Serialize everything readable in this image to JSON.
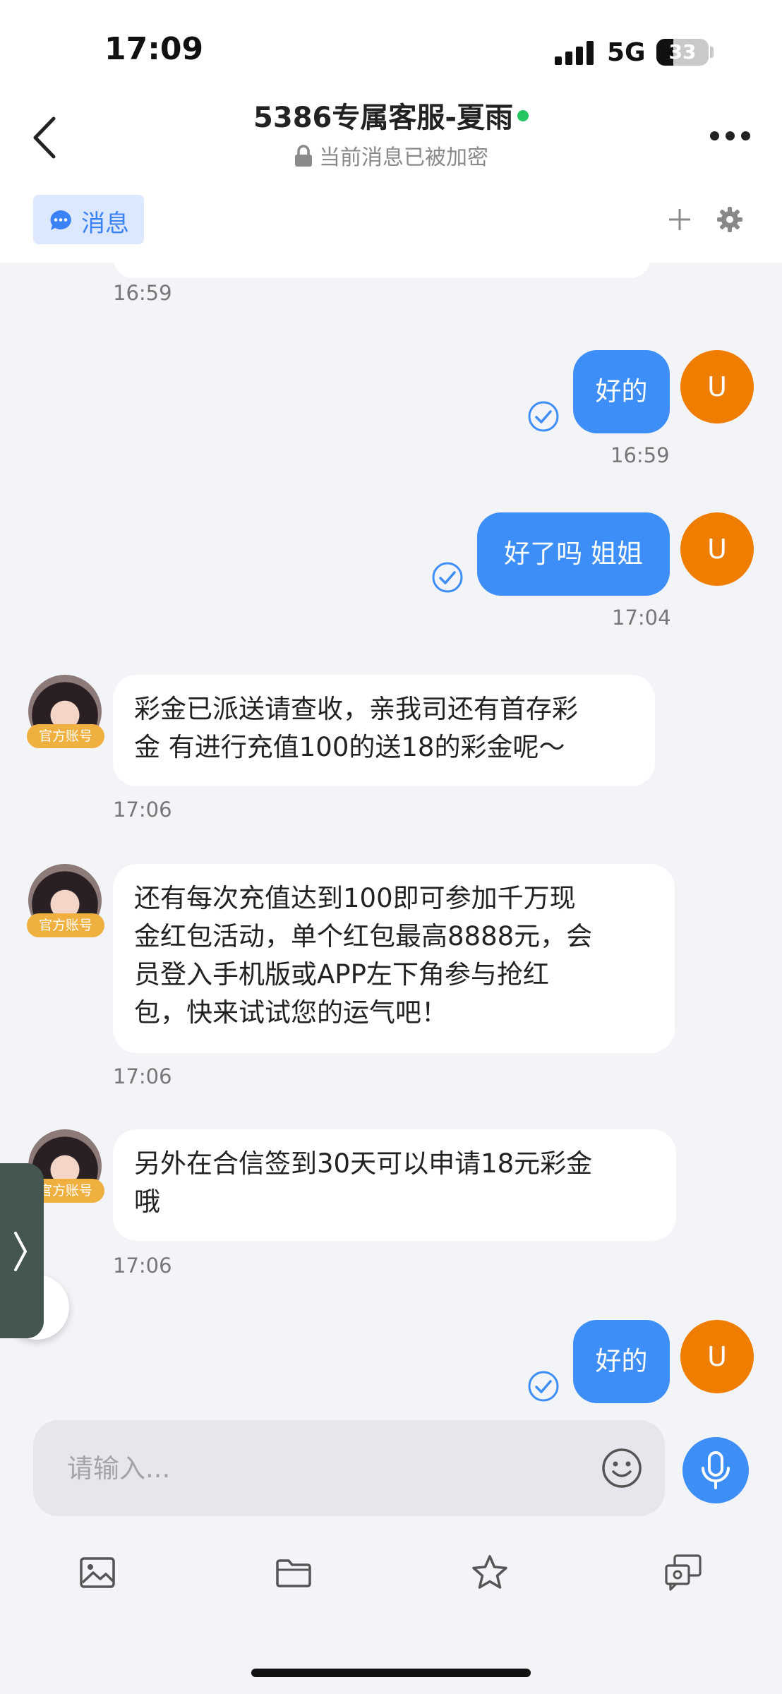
{
  "status_bar": {
    "time": "17:09",
    "network": "5G",
    "battery": "33",
    "battery_level": 0.33
  },
  "header": {
    "title": "5386专属客服-夏雨",
    "subtitle": "当前消息已被加密",
    "online_color": "#22c55e"
  },
  "tabs": {
    "message": "消息"
  },
  "colors": {
    "accent": "#3e8ef7",
    "user_avatar": "#ef7d00",
    "badge": "#f0b040"
  },
  "messages": [
    {
      "from": "agent-partial",
      "time": "16:59"
    },
    {
      "from": "user",
      "text": "好的",
      "time": "16:59",
      "avatar": "U"
    },
    {
      "from": "user",
      "text": "好了吗 姐姐",
      "time": "17:04",
      "avatar": "U"
    },
    {
      "from": "agent",
      "badge": "官方账号",
      "lines": [
        "彩金已派送请查收，亲我司还有首存彩",
        "金 有进行充值100的送18的彩金呢～"
      ],
      "time": "17:06"
    },
    {
      "from": "agent",
      "badge": "官方账号",
      "lines": [
        "还有每次充值达到100即可参加千万现",
        "金红包活动，单个红包最高8888元，会",
        "员登入手机版或APP左下角参与抢红",
        "包，快来试试您的运气吧！"
      ],
      "time": "17:06"
    },
    {
      "from": "agent",
      "badge": "官方账号",
      "lines": [
        "另外在合信签到30天可以申请18元彩金",
        "哦"
      ],
      "time": "17:06"
    },
    {
      "from": "user",
      "text": "好的",
      "avatar": "U"
    }
  ],
  "composer": {
    "placeholder": "请输入...",
    "value": ""
  },
  "toolbar": [
    "image-icon",
    "folder-icon",
    "star-icon",
    "forward-chat-icon"
  ]
}
